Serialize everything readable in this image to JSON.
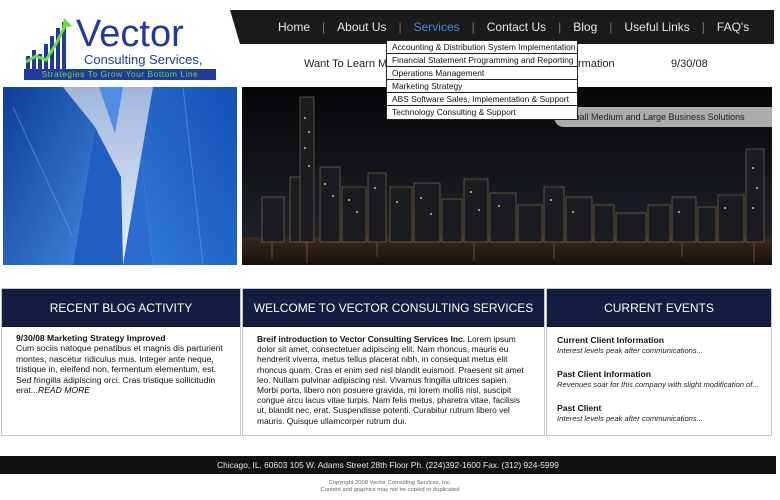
{
  "logo": {
    "title": "Vector",
    "subtitle": "Consulting Services, Inc.",
    "tagline": "Strategies To Grow Your Bottom Line"
  },
  "nav": {
    "items": [
      {
        "label": "Home"
      },
      {
        "label": "About Us"
      },
      {
        "label": "Services"
      },
      {
        "label": "Contact Us"
      },
      {
        "label": "Blog"
      },
      {
        "label": "Useful Links"
      },
      {
        "label": "FAQ's"
      }
    ],
    "active": "Services",
    "active_color": "#3f8de8"
  },
  "hero": {
    "text_left": "Want To Learn Mo",
    "text_right": "rmation",
    "date": "9/30/08",
    "slogan": "mall Medium and Large Business Solutions"
  },
  "dropdown": {
    "items": [
      "Accounting & Distribution System Implementation",
      "Financial Statement Programming and Reporting",
      "Operations Management",
      "Marketing Strategy",
      "ABS Software Sales, Implementation & Support",
      "Technology Consulting & Support"
    ]
  },
  "blog": {
    "heading": "RECENT BLOG ACTIVITY",
    "post_title": "9/30/08  Marketing Strategy Improved",
    "post_body": "Cum sociis natoque penatibus et magnis dis parturient montes, nascetur ridiculus mus. Integer ante neque, tristique in, eleifend non, fermentum elementum, est. Sed fringilla adipiscing orci. Cras tristique sollicitudin erat...",
    "read_more": "READ MORE"
  },
  "welcome": {
    "heading": "WELCOME TO VECTOR CONSULTING SERVICES",
    "lead": "Breif introduction to Vector Consulting Services Inc.",
    "body": "Lorem ipsum dolor sit amet, consectetuer adipiscing elit. Nam rhoncus, mauris eu hendrerit viverra, metus tellus placerat nibh, in consequat metus elit rhoncus quam. Cras et enim sed nisl blandit euismod. Praesent sit amet leo. Nullam pulvinar adipiscing nisl. Vivamus fringilla ultrices sapien. Morbi porta, libero non posuere gravida, mi lorem mollis nisl, suscipit congue arcu lacus vitae turpis. Nam felis metus, pharetra vitae, facilisis ut, blandit nec, erat. Suspendisse potenti. Curabitur rutrum libero vel mauris. Quisque ullamcorper rutrum dui."
  },
  "events": {
    "heading": "CURRENT EVENTS",
    "items": [
      {
        "title": "Current Client Information",
        "desc": "Interest levels peak after communications..."
      },
      {
        "title": "Past Client Information",
        "desc": "Revenues soar for this company with slight modification of..."
      },
      {
        "title": "Past Client",
        "desc": "Interest levels peak after communications..."
      }
    ]
  },
  "footer": {
    "address": "Chicago, IL.  60603   105 W. Adams Street  28th Floor    Ph. (224)392-1600  Fax. (312) 924-5999",
    "copyright_line1": "Copyright 2008 Vector Consulting Services, Inc.",
    "copyright_line2": "Content and graphics may not be copied or duplicated"
  },
  "colors": {
    "brand_blue": "#1f3a9c",
    "brand_green": "#6cdc3c",
    "panel_header": "#141c40",
    "nav_bg": "#1b1b1b"
  }
}
